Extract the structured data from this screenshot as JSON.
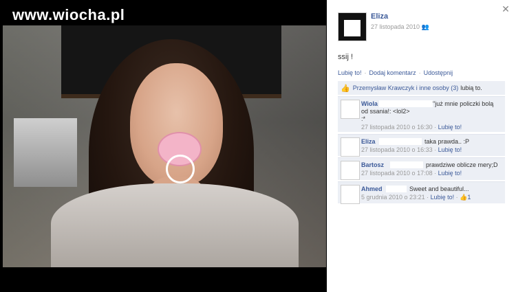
{
  "site": {
    "watermark": "www.wiocha.pl"
  },
  "post": {
    "author": "Eliza",
    "date": "27 listopada 2010",
    "status": "ssij !",
    "actions": [
      "Lubię to!",
      "Dodaj komentarz",
      "Udostępnij"
    ],
    "likes_name": "Przemysław Krawczyk i inne osoby (3)",
    "likes_tail": "lubią to."
  },
  "comments": [
    {
      "name": "Wiola",
      "text": "\"już mnie policzki bolą od ssania!: <lol2>\n:*",
      "time": "27 listopada 2010 o 16:30",
      "like": "Lubię to!"
    },
    {
      "name": "Eliza",
      "text": "taka prawda.. :P",
      "time": "27 listopada 2010 o 16:33",
      "like": "Lubię to!"
    },
    {
      "name": "Bartosz",
      "text": "prawdziwe oblicze mery;D",
      "time": "27 listopada 2010 o 17:08",
      "like": "Lubię to!"
    },
    {
      "name": "Ahmed",
      "text": "Sweet and beautiful...",
      "time": "5 grudnia 2010 o 23:21",
      "like": "Lubię to!",
      "likes_count": "1"
    }
  ],
  "colors": {
    "link": "#3b5998",
    "panel_bg": "#ffffff",
    "comment_bg": "#eceff5"
  }
}
